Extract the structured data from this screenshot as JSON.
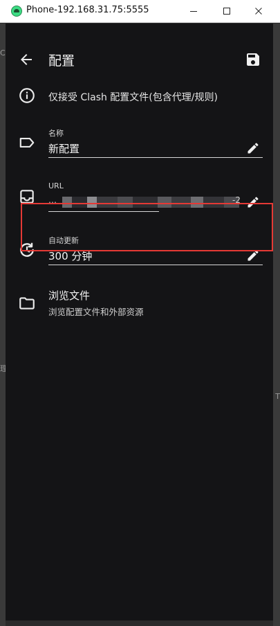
{
  "window": {
    "title": "Phone-192.168.31.75:5555"
  },
  "background": {
    "left_fragments": [
      "C",
      "理"
    ],
    "right_fragments": [
      "T"
    ]
  },
  "appbar": {
    "title": "配置"
  },
  "info": {
    "text": "仅接受 Clash 配置文件(包含代理/规则)"
  },
  "fields": {
    "name": {
      "label": "名称",
      "value": "新配置"
    },
    "url": {
      "label": "URL",
      "value_visible_start": "… ",
      "value_visible_end": "-2"
    },
    "auto_update": {
      "label": "自动更新",
      "value": "300 分钟"
    }
  },
  "browse": {
    "title": "浏览文件",
    "subtitle": "浏览配置文件和外部资源"
  },
  "colors": {
    "app_background": "#141416",
    "highlight": "#e53935",
    "text_primary": "#f1f1f1"
  },
  "icons": {
    "back": "arrow-left-icon",
    "save": "save-icon",
    "info": "info-icon",
    "name": "label-tag-icon",
    "url": "inbox-icon",
    "auto_update": "refresh-clock-icon",
    "browse": "folder-icon",
    "edit": "pencil-icon"
  }
}
